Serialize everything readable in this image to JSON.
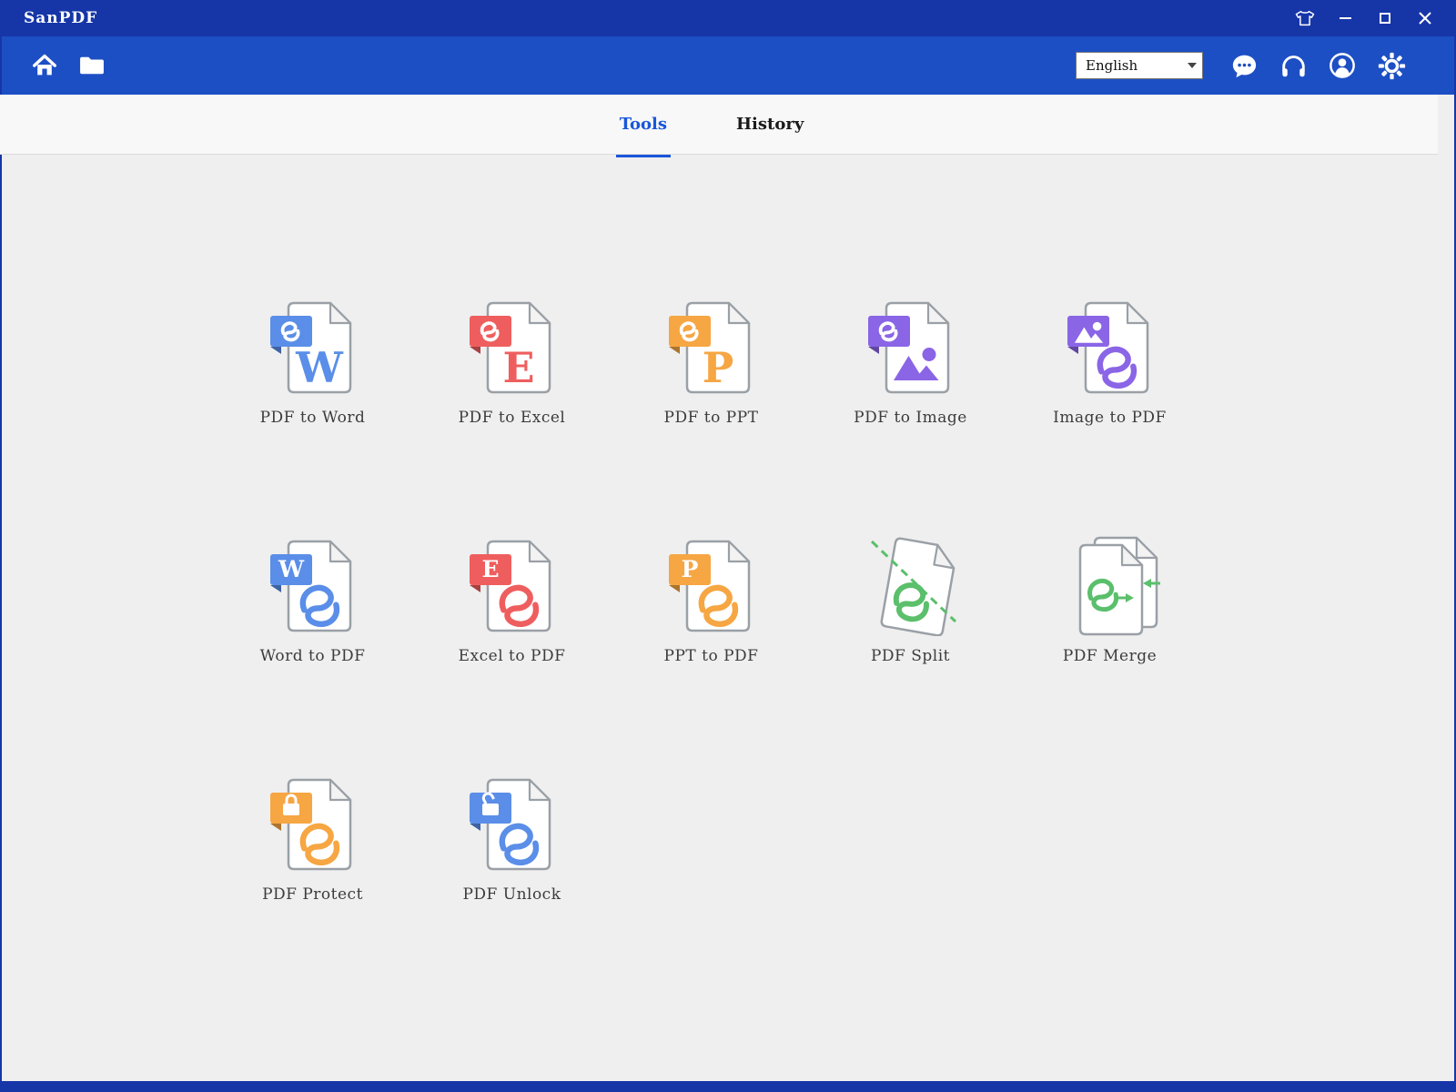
{
  "titlebar": {
    "app_title": "SanPDF"
  },
  "window_controls": [
    "skin-theme",
    "minimize",
    "maximize",
    "close"
  ],
  "toolbar": {
    "language": {
      "value": "English"
    },
    "buttons": [
      "home",
      "open-folder",
      "feedback",
      "support",
      "account",
      "settings"
    ]
  },
  "tabs": [
    {
      "label": "Tools",
      "active": true
    },
    {
      "label": "History",
      "active": false
    }
  ],
  "tools": [
    {
      "label": "PDF to Word",
      "variant": "convert",
      "badge_glyph": "pdf",
      "body_glyph": "W",
      "color": "#5a8ee8"
    },
    {
      "label": "PDF to Excel",
      "variant": "convert",
      "badge_glyph": "pdf",
      "body_glyph": "E",
      "color": "#ef5e5e"
    },
    {
      "label": "PDF to PPT",
      "variant": "convert",
      "badge_glyph": "pdf",
      "body_glyph": "P",
      "color": "#f6a643"
    },
    {
      "label": "PDF to Image",
      "variant": "convert",
      "badge_glyph": "pdf",
      "body_glyph": "image",
      "color": "#8a65e6"
    },
    {
      "label": "Image to PDF",
      "variant": "convert",
      "badge_glyph": "image",
      "body_glyph": "pdf",
      "color": "#8a65e6"
    },
    {
      "label": "Word to PDF",
      "variant": "convert",
      "badge_glyph": "W",
      "body_glyph": "pdf",
      "color": "#5a8ee8"
    },
    {
      "label": "Excel to PDF",
      "variant": "convert",
      "badge_glyph": "E",
      "body_glyph": "pdf",
      "color": "#ef5e5e"
    },
    {
      "label": "PPT to PDF",
      "variant": "convert",
      "badge_glyph": "P",
      "body_glyph": "pdf",
      "color": "#f6a643"
    },
    {
      "label": "PDF Split",
      "variant": "split",
      "color": "#5bbf6b"
    },
    {
      "label": "PDF Merge",
      "variant": "merge",
      "color": "#5bbf6b"
    },
    {
      "label": "PDF Protect",
      "variant": "convert",
      "badge_glyph": "lock",
      "body_glyph": "pdf",
      "color": "#f6a643"
    },
    {
      "label": "PDF Unlock",
      "variant": "convert",
      "badge_glyph": "unlock",
      "body_glyph": "pdf",
      "color": "#5a8ee8"
    }
  ],
  "colors": {
    "titlebar": "#1636a8",
    "toolbar": "#1d4fc4",
    "active_tab": "#1a56db",
    "content_bg": "#efefef",
    "blue": "#5a8ee8",
    "red": "#ef5e5e",
    "orange": "#f6a643",
    "purple": "#8a65e6",
    "green": "#5bbf6b"
  }
}
